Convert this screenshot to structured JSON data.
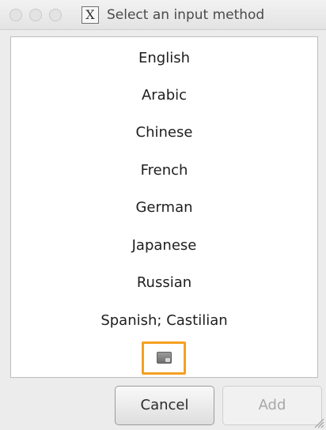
{
  "window": {
    "title": "Select an input method",
    "app_icon_glyph": "X"
  },
  "input_methods": [
    {
      "label": "English"
    },
    {
      "label": "Arabic"
    },
    {
      "label": "Chinese"
    },
    {
      "label": "French"
    },
    {
      "label": "German"
    },
    {
      "label": "Japanese"
    },
    {
      "label": "Russian"
    },
    {
      "label": "Spanish; Castilian"
    }
  ],
  "buttons": {
    "cancel_label": "Cancel",
    "add_label": "Add",
    "add_enabled": false
  },
  "icons": {
    "window_close": "close-icon",
    "window_minimize": "minimize-icon",
    "window_maximize": "maximize-icon",
    "app": "x11-icon",
    "keyboard": "keyboard-icon",
    "resize": "resize-grip-icon"
  },
  "colors": {
    "highlight": "#f5a021",
    "list_background": "#ffffff",
    "window_background": "#ececec",
    "disabled_text": "#a8a8a8"
  }
}
